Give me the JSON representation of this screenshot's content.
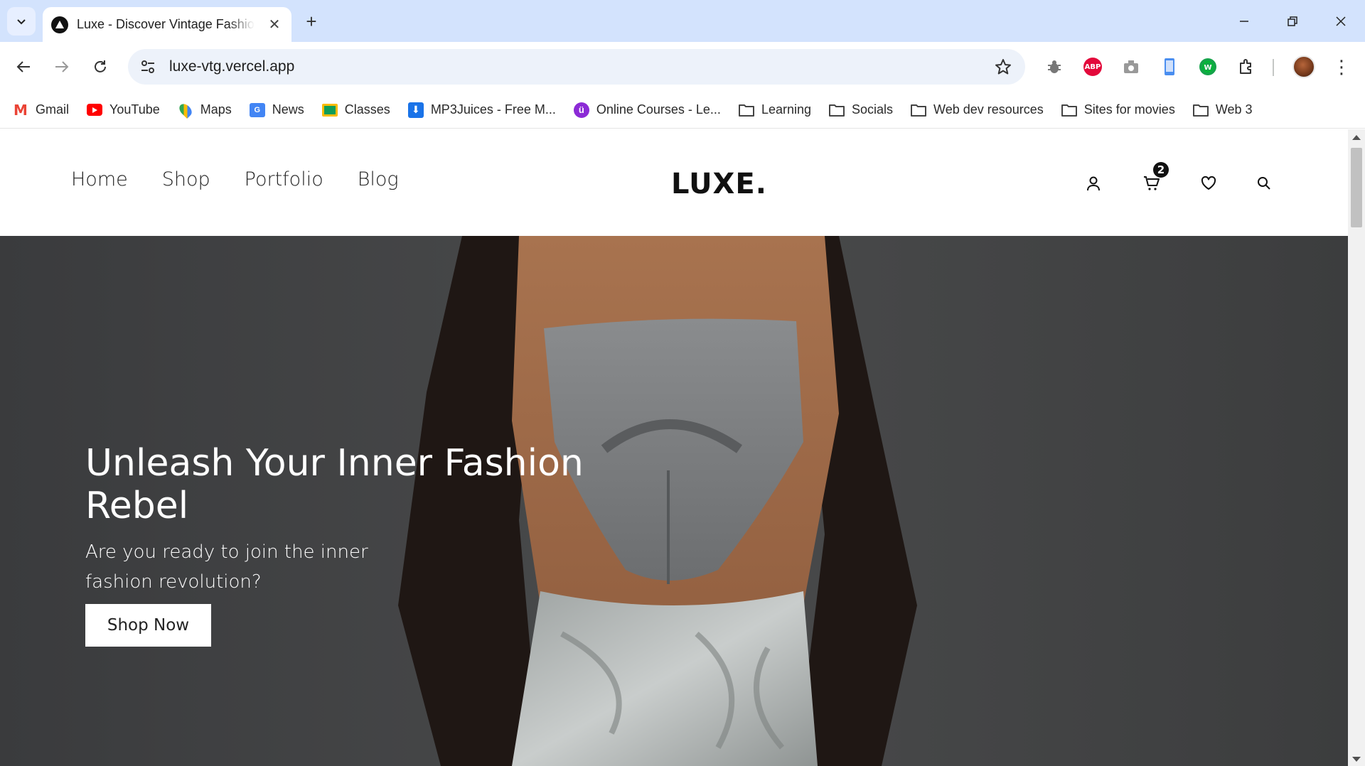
{
  "browser": {
    "tab_title": "Luxe - Discover Vintage Fashion",
    "url": "luxe-vtg.vercel.app",
    "bookmarks": [
      {
        "label": "Gmail",
        "icon": "gmail-icon"
      },
      {
        "label": "YouTube",
        "icon": "youtube-icon"
      },
      {
        "label": "Maps",
        "icon": "maps-icon"
      },
      {
        "label": "News",
        "icon": "news-icon"
      },
      {
        "label": "Classes",
        "icon": "classes-icon"
      },
      {
        "label": "MP3Juices - Free M...",
        "icon": "download-icon"
      },
      {
        "label": "Online Courses - Le...",
        "icon": "udemy-icon"
      },
      {
        "label": "Learning",
        "icon": "folder-icon"
      },
      {
        "label": "Socials",
        "icon": "folder-icon"
      },
      {
        "label": "Web dev resources",
        "icon": "folder-icon"
      },
      {
        "label": "Sites for movies",
        "icon": "folder-icon"
      },
      {
        "label": "Web 3",
        "icon": "folder-icon"
      }
    ],
    "abp_label": "ABP"
  },
  "site": {
    "nav": [
      "Home",
      "Shop",
      "Portfolio",
      "Blog"
    ],
    "logo": "LUXE.",
    "cart_count": "2"
  },
  "hero": {
    "title": "Unleash Your Inner Fashion Rebel",
    "subtitle": "Are you ready to join the inner fashion revolution?",
    "cta": "Shop Now"
  },
  "colors": {
    "tabbar_bg": "#d3e3fd",
    "omnibox_bg": "#edf2fa",
    "hero_bg": "#3e3f40",
    "accent_text": "#ffffff"
  }
}
